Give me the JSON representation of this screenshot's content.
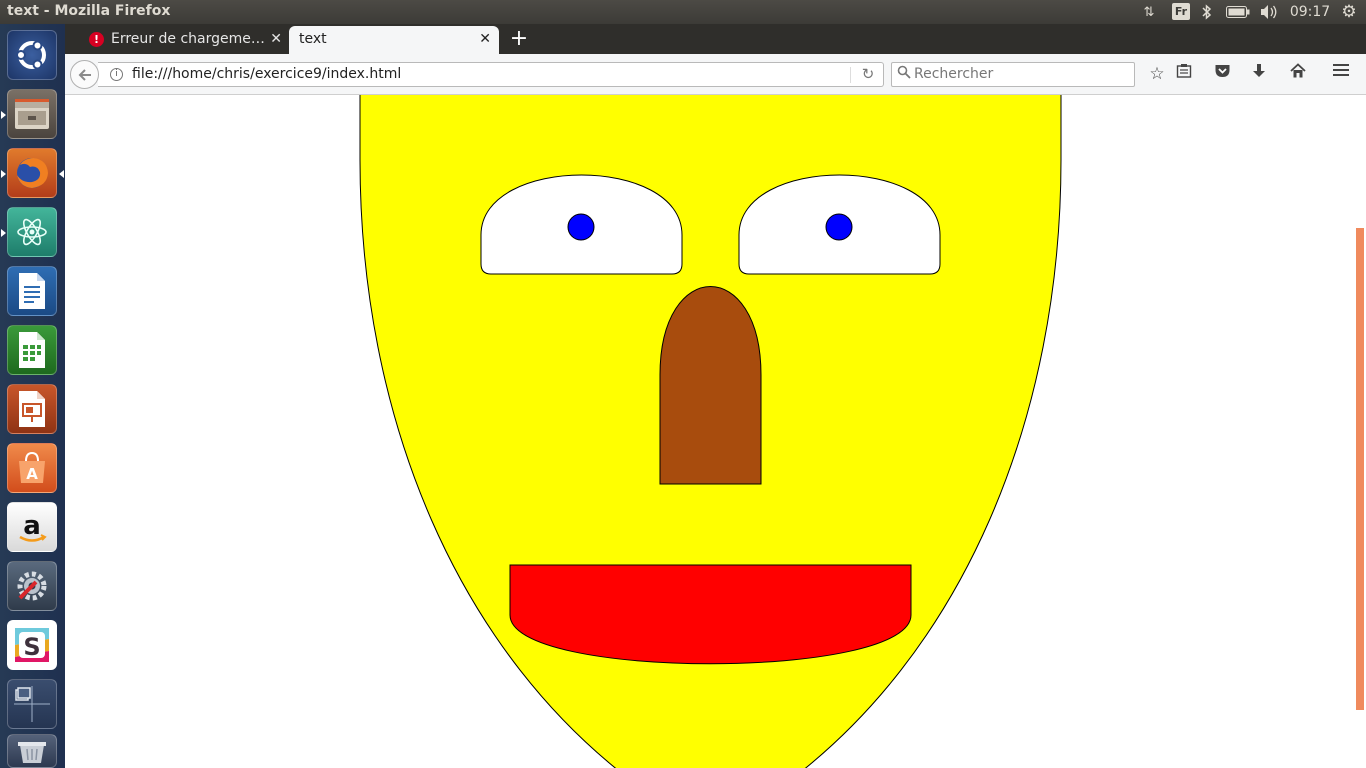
{
  "panel": {
    "window_title": "text - Mozilla Firefox",
    "keyboard_layout": "Fr",
    "clock": "09:17",
    "indicators": [
      "network-icon",
      "keyboard-icon",
      "bluetooth-icon",
      "battery-icon",
      "volume-icon",
      "system-gear-icon"
    ]
  },
  "launcher": {
    "items": [
      "ubuntu-dash-icon",
      "files-icon",
      "firefox-icon",
      "atom-icon",
      "libreoffice-writer-icon",
      "libreoffice-calc-icon",
      "libreoffice-impress-icon",
      "software-center-icon",
      "amazon-icon",
      "system-settings-icon",
      "slack-icon",
      "workspace-switcher-icon",
      "trash-icon"
    ]
  },
  "tabs": [
    {
      "label": "Erreur de chargeme…",
      "status": "error"
    },
    {
      "label": "text",
      "active": true
    }
  ],
  "navbar": {
    "url": "file:///home/chris/exercice9/index.html",
    "search_placeholder": "Rechercher"
  },
  "colors": {
    "face": "#ffff00",
    "eye": "#ffffff",
    "pupil": "#0000ff",
    "nose": "#a84c0d",
    "mouth": "#ff0000",
    "launcher": "#223456",
    "scroll_thumb": "#f08a5d"
  }
}
